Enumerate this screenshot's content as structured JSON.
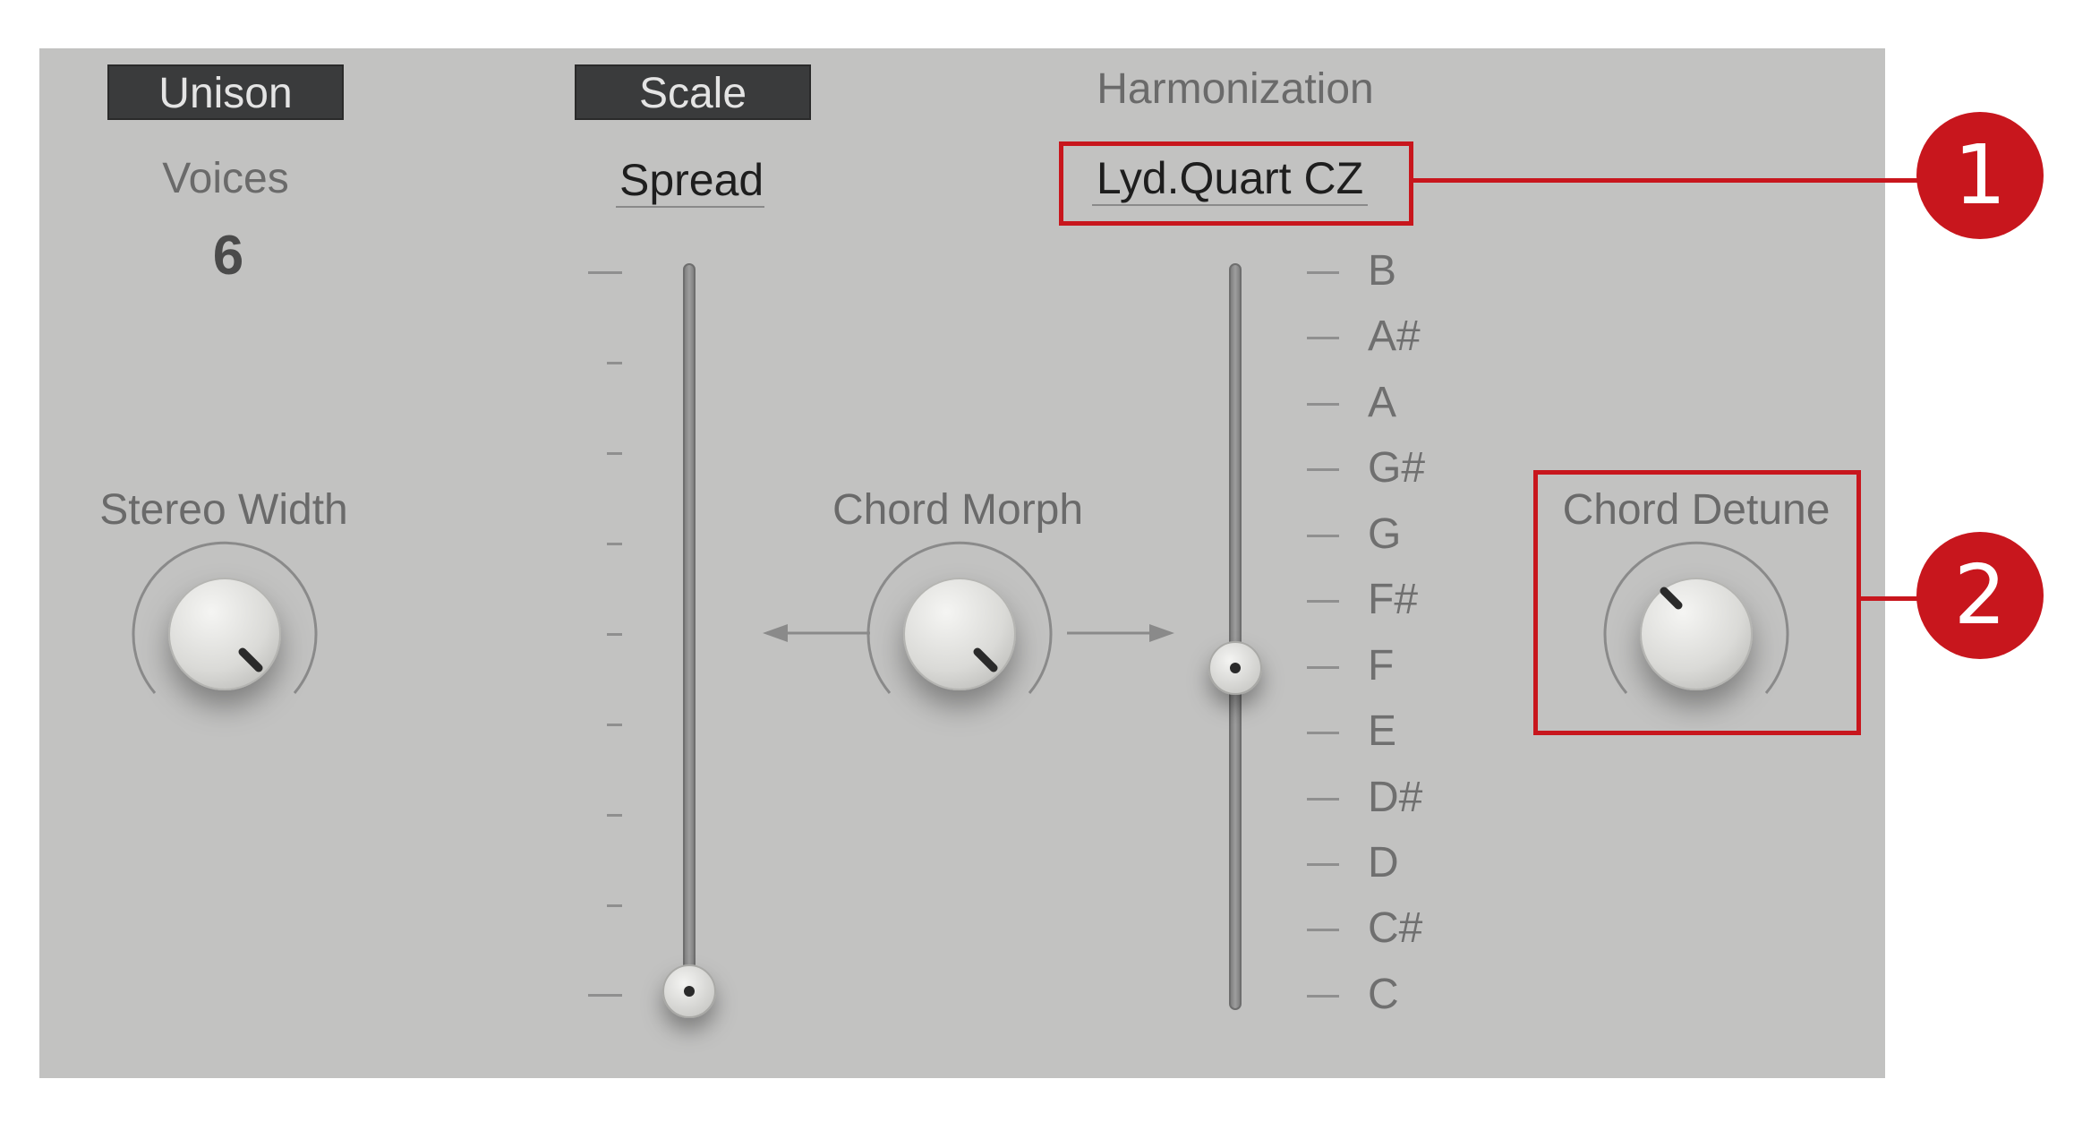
{
  "tabs": {
    "unison": "Unison",
    "scale": "Scale"
  },
  "harmonization": {
    "title": "Harmonization",
    "chord_mode": "Lyd.Quart CZ",
    "notes": [
      "B",
      "A#",
      "A",
      "G#",
      "G",
      "F#",
      "F",
      "E",
      "D#",
      "D",
      "C#",
      "C"
    ],
    "selected_note": "F"
  },
  "voices": {
    "label": "Voices",
    "value": "6"
  },
  "spread": {
    "label": "Spread",
    "level": 0.0
  },
  "controls": {
    "stereo_width": "Stereo Width",
    "chord_morph": "Chord Morph",
    "chord_detune": "Chord Detune"
  },
  "callouts": {
    "one": "1",
    "two": "2"
  },
  "colors": {
    "panel": "#c2c2c1",
    "tab": "#3a3b3c",
    "callout": "#c8161d"
  }
}
